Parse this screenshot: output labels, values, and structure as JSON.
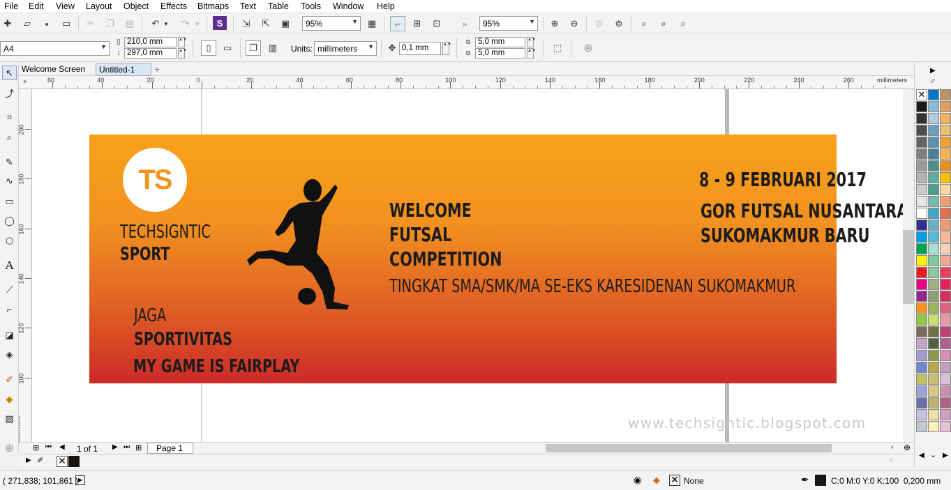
{
  "menu": [
    "File",
    "Edit",
    "View",
    "Layout",
    "Object",
    "Effects",
    "Bitmaps",
    "Text",
    "Table",
    "Tools",
    "Window",
    "Help"
  ],
  "toolbar": {
    "zoom1": "95%",
    "zoom2": "95%"
  },
  "property_bar": {
    "page_size": "A4",
    "width": "210,0 mm",
    "height": "297,0 mm",
    "units_label": "Units:",
    "units": "millimeters",
    "nudge": "0,1 mm",
    "dup_x": "5,0 mm",
    "dup_y": "5,0 mm"
  },
  "doc_tabs": [
    "Welcome Screen",
    "Untitled-1"
  ],
  "ruler": {
    "h_labels": [
      "60",
      "40",
      "20",
      "0",
      "20",
      "40",
      "60",
      "80",
      "100",
      "120",
      "140",
      "160",
      "180",
      "200",
      "220",
      "240",
      "260"
    ],
    "unit": "millimeters",
    "v_labels": [
      "200",
      "180",
      "160",
      "140",
      "120",
      "100"
    ],
    "v_unit": "millimeters"
  },
  "poster": {
    "logo": "TS",
    "brand_line1": "TECHSIGNTIC",
    "brand_line2": "SPORT",
    "title_line1": "WELCOME",
    "title_line2": "FUTSAL",
    "title_line3": "COMPETITION",
    "subtitle": "TINGKAT SMA/SMK/MA SE-EKS KARESIDENAN SUKOMAKMUR",
    "date": "8 - 9 FEBRUARI 2017",
    "venue_line1": "GOR FUTSAL NUSANTARA",
    "venue_line2": "SUKOMAKMUR BARU",
    "slogan_line1": "JAGA",
    "slogan_line2": "SPORTIVITAS",
    "slogan_line3": "MY GAME IS FAIRPLAY"
  },
  "watermark": "www.techsigntic.blogspot.com",
  "page_nav": {
    "counter": "1 of 1",
    "page_tab": "Page 1"
  },
  "status": {
    "coords": "( 271,838; 101,861 )",
    "fill": "None",
    "outline": "C:0 M:0 Y:0 K:100  0,200 mm"
  },
  "palette": {
    "col1": [
      "#ffffff",
      "#1a1a1a",
      "#333333",
      "#4d4d4d",
      "#666666",
      "#808080",
      "#999999",
      "#b3b3b3",
      "#cccccc",
      "#e6e6e6",
      "#ffffff",
      "#2e3192",
      "#00a0e0",
      "#00a651",
      "#fff200",
      "#ed1c24",
      "#ec008c",
      "#92278f",
      "#f7941d",
      "#8dc63f",
      "#7d6c5c",
      "#c8a2c8",
      "#a59bd1",
      "#6d8ad0",
      "#c0c060",
      "#9aa0d8",
      "#6a70a8",
      "#c8c0e0",
      "#bfc7d0"
    ],
    "col2": [
      "#0077c8",
      "#8fb9d8",
      "#aecbe0",
      "#6ca0c0",
      "#5e8fae",
      "#4a7f9e",
      "#4a8f8a",
      "#5fae9a",
      "#4a9f8a",
      "#78b8b0",
      "#40a8c0",
      "#6ab0c8",
      "#58b8d8",
      "#a8e0d0",
      "#7fc8a0",
      "#8cc8a0",
      "#a0b080",
      "#8fa070",
      "#9fb060",
      "#c8e070",
      "#707040",
      "#506040",
      "#8a9a50",
      "#b8a850",
      "#c8c070",
      "#d8c880",
      "#c0b070",
      "#f0e0a0",
      "#f8f0c0"
    ],
    "col3": [
      "#c09060",
      "#e0a060",
      "#f0b060",
      "#e8c070",
      "#f0a030",
      "#f8b050",
      "#e89020",
      "#f8c000",
      "#f8d8a0",
      "#f0a070",
      "#e07050",
      "#f09870",
      "#f8b898",
      "#f8d0b8",
      "#f0a890",
      "#e84060",
      "#e8205a",
      "#d03060",
      "#e06080",
      "#e898a8",
      "#c04070",
      "#b06090",
      "#d890b8",
      "#c0a0c0",
      "#d8c0d8",
      "#c890b0",
      "#b06080",
      "#d0a0c0",
      "#e8c0d8"
    ]
  }
}
